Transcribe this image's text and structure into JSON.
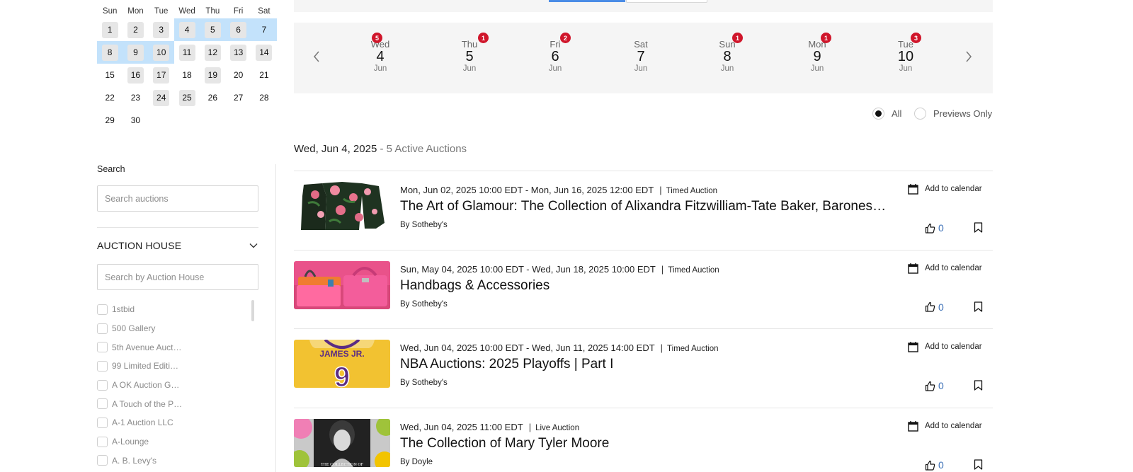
{
  "mini_calendar": {
    "weekdays": [
      "Sun",
      "Mon",
      "Tue",
      "Wed",
      "Thu",
      "Fri",
      "Sat"
    ],
    "weeks": [
      [
        "1",
        "2",
        "3",
        "4",
        "5",
        "6",
        "7"
      ],
      [
        "8",
        "9",
        "10",
        "11",
        "12",
        "13",
        "14"
      ],
      [
        "15",
        "16",
        "17",
        "18",
        "19",
        "20",
        "21"
      ],
      [
        "22",
        "23",
        "24",
        "25",
        "26",
        "27",
        "28"
      ],
      [
        "29",
        "30",
        "",
        "",
        "",
        "",
        ""
      ]
    ],
    "days_with_auctions": [
      "1",
      "2",
      "3",
      "4",
      "5",
      "6",
      "8",
      "9",
      "10",
      "11",
      "12",
      "13",
      "14",
      "16",
      "17",
      "19",
      "24",
      "25"
    ],
    "selected_range": [
      "4",
      "5",
      "6",
      "7",
      "8",
      "9",
      "10"
    ]
  },
  "sidebar": {
    "search_label": "Search",
    "search_placeholder": "Search auctions",
    "auction_house_title": "AUCTION HOUSE",
    "auction_house_placeholder": "Search by Auction House",
    "houses": [
      "1stbid",
      "500 Gallery",
      "5th Avenue Auct…",
      "99 Limited Editi…",
      "A OK Auction G…",
      "A Touch of the P…",
      "A-1 Auction LLC",
      "A-Lounge",
      "A. B. Levy's"
    ]
  },
  "date_strip": {
    "days": [
      {
        "dow": "Wed",
        "num": "4",
        "mon": "Jun",
        "badge": "5"
      },
      {
        "dow": "Thu",
        "num": "5",
        "mon": "Jun",
        "badge": "1"
      },
      {
        "dow": "Fri",
        "num": "6",
        "mon": "Jun",
        "badge": "2"
      },
      {
        "dow": "Sat",
        "num": "7",
        "mon": "Jun",
        "badge": ""
      },
      {
        "dow": "Sun",
        "num": "8",
        "mon": "Jun",
        "badge": "1"
      },
      {
        "dow": "Mon",
        "num": "9",
        "mon": "Jun",
        "badge": "1"
      },
      {
        "dow": "Tue",
        "num": "10",
        "mon": "Jun",
        "badge": "3"
      }
    ]
  },
  "filters": {
    "all_label": "All",
    "previews_label": "Previews Only"
  },
  "heading": {
    "date": "Wed, Jun 4, 2025",
    "count": " - 5 Active Auctions"
  },
  "auctions": [
    {
      "dates": "Mon, Jun 02, 2025 10:00 EDT - Mon, Jun 16, 2025 12:00 EDT",
      "type": "Timed Auction",
      "title": "The Art of Glamour: The Collection of Alixandra Fitzwilliam-Tate Baker, Baroness Baker",
      "by": "By Sotheby's",
      "add_calendar": "Add to calendar",
      "likes": "0",
      "thumb": "floral-dress"
    },
    {
      "dates": "Sun, May 04, 2025 10:00 EDT - Wed, Jun 18, 2025 10:00 EDT",
      "type": "Timed Auction",
      "title": "Handbags & Accessories",
      "by": "By Sotheby's",
      "add_calendar": "Add to calendar",
      "likes": "0",
      "thumb": "handbags"
    },
    {
      "dates": "Wed, Jun 04, 2025 10:00 EDT - Wed, Jun 11, 2025 14:00 EDT",
      "type": "Timed Auction",
      "title": "NBA Auctions: 2025 Playoffs | Part I",
      "by": "By Sotheby's",
      "add_calendar": "Add to calendar",
      "likes": "0",
      "thumb": "jersey",
      "thumb_text": "JAMES JR.",
      "thumb_number": "9"
    },
    {
      "dates": "Wed, Jun 04, 2025 11:00 EDT",
      "type": "Live Auction",
      "title": "The Collection of Mary Tyler Moore",
      "by": "By Doyle",
      "add_calendar": "Add to calendar",
      "likes": "0",
      "thumb": "portrait",
      "thumb_text": "THE COLLECTION OF"
    }
  ],
  "colors": {
    "badge": "#d0162b",
    "range_highlight": "#c3e2fb",
    "likes": "#3b6fb6",
    "tab_active": "#4a8ce6"
  }
}
